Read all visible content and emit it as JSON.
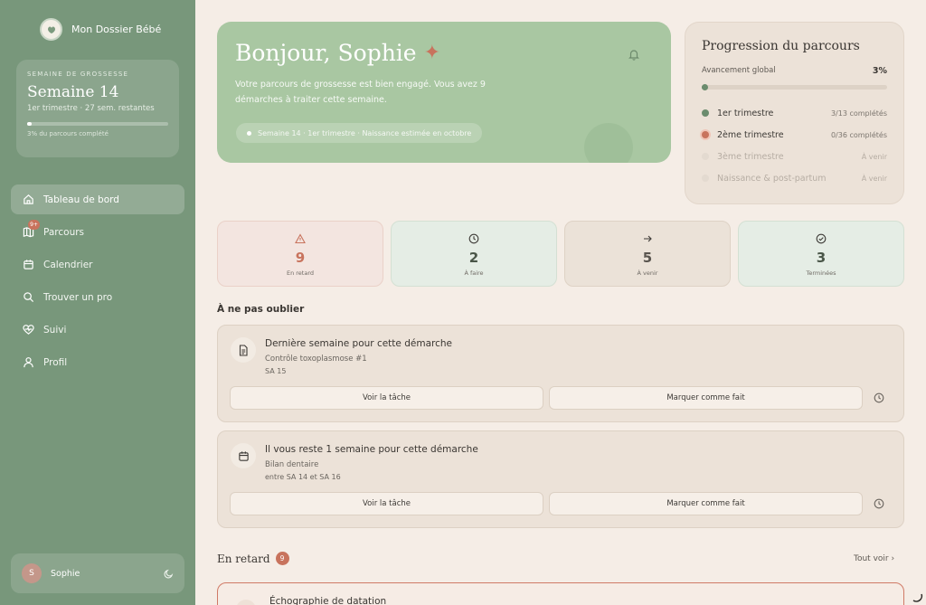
{
  "app": {
    "name": "Mon Dossier Bébé"
  },
  "sidebar": {
    "week_card": {
      "kicker": "SEMAINE DE GROSSESSE",
      "title": "Semaine 14",
      "subtitle": "1er trimestre · 27 sem. restantes",
      "progress_pct": 3,
      "note": "3% du parcours complété"
    },
    "nav": [
      {
        "label": "Tableau de bord",
        "icon": "home-icon",
        "active": true
      },
      {
        "label": "Parcours",
        "icon": "map-icon",
        "badge": "9+"
      },
      {
        "label": "Calendrier",
        "icon": "calendar-icon"
      },
      {
        "label": "Trouver un pro",
        "icon": "search-icon"
      },
      {
        "label": "Suivi",
        "icon": "heart-pulse-icon"
      },
      {
        "label": "Profil",
        "icon": "user-icon"
      }
    ],
    "user": {
      "initial": "S",
      "name": "Sophie",
      "theme_icon": "moon-icon"
    }
  },
  "hero": {
    "greeting": "Bonjour, Sophie",
    "star": "✦",
    "message": "Votre parcours de grossesse est bien engagé. Vous avez 9 démarches à traiter cette semaine.",
    "pill": "Semaine 14 · 1er trimestre · Naissance estimée en octobre"
  },
  "progress": {
    "title": "Progression du parcours",
    "overall_label": "Avancement global",
    "overall_pct": "3%",
    "overall_value": 3,
    "trimesters": [
      {
        "name": "1er trimestre",
        "stat": "3/13 complétés",
        "color": "#6b8c6e",
        "muted": false
      },
      {
        "name": "2ème trimestre",
        "stat": "0/36 complétés",
        "color": "#c8735d",
        "muted": false
      },
      {
        "name": "3ème trimestre",
        "stat": "À venir",
        "color": "#e3dad0",
        "muted": true
      },
      {
        "name": "Naissance & post-partum",
        "stat": "À venir",
        "color": "#e3dad0",
        "muted": true
      }
    ]
  },
  "stats": [
    {
      "value": "9",
      "label": "En retard",
      "icon": "alert-triangle-icon"
    },
    {
      "value": "2",
      "label": "À faire",
      "icon": "clock-icon"
    },
    {
      "value": "5",
      "label": "À venir",
      "icon": "arrow-right-icon"
    },
    {
      "value": "3",
      "label": "Terminées",
      "icon": "check-circle-icon"
    }
  ],
  "reminders": {
    "title": "À ne pas oublier",
    "tasks": [
      {
        "title": "Dernière semaine pour cette démarche",
        "subtitle": "Contrôle toxoplasmose #1",
        "date": "SA 15",
        "icon": "document-icon",
        "view_label": "Voir la tâche",
        "done_label": "Marquer comme fait"
      },
      {
        "title": "Il vous reste 1 semaine pour cette démarche",
        "subtitle": "Bilan dentaire",
        "date": "entre SA 14 et SA 16",
        "icon": "calendar-icon",
        "view_label": "Voir la tâche",
        "done_label": "Marquer comme fait"
      }
    ]
  },
  "overdue": {
    "title": "En retard",
    "count": "9",
    "see_all": "Tout voir ›",
    "first_item": "Échographie de datation"
  },
  "colors": {
    "sidebar": "#78977b",
    "hero": "#a9c7a2",
    "accent": "#c8735d",
    "background": "#f5ede6"
  }
}
